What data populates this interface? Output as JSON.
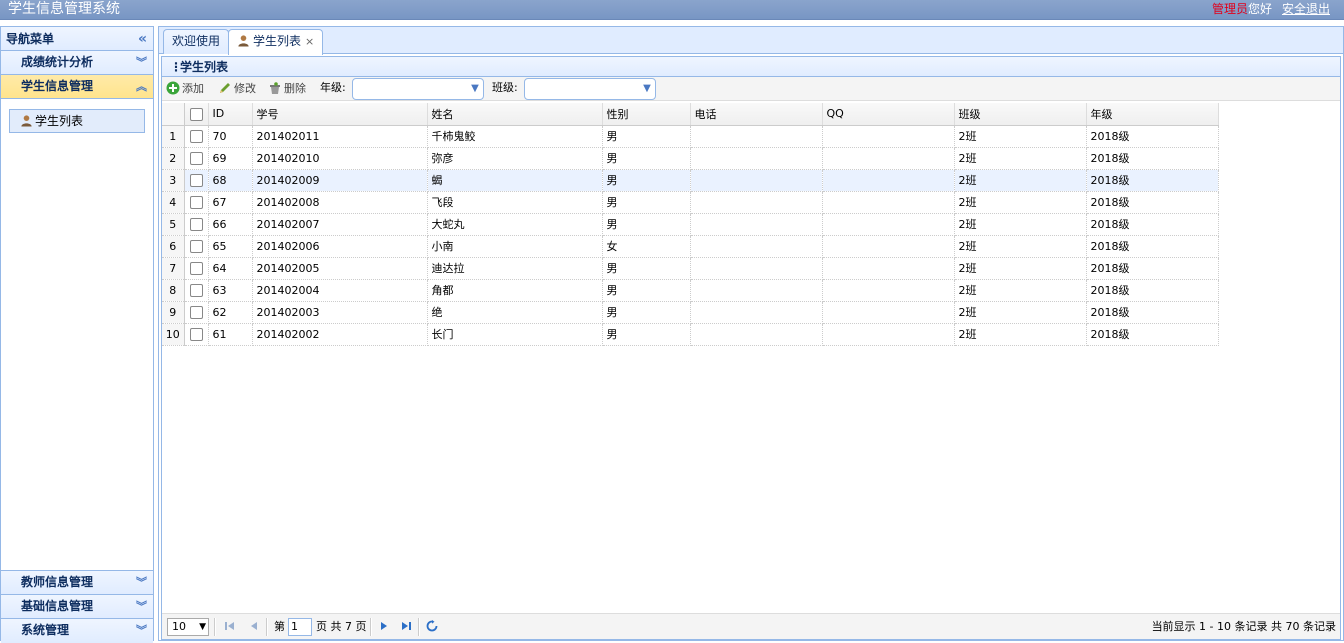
{
  "app": {
    "title": "学生信息管理系统"
  },
  "header": {
    "role": "管理员",
    "greeting": "您好",
    "logout": "安全退出"
  },
  "sidebar": {
    "title": "导航菜单",
    "groups": [
      {
        "label": "成绩统计分析"
      },
      {
        "label": "学生信息管理"
      },
      {
        "label": "教师信息管理"
      },
      {
        "label": "基础信息管理"
      },
      {
        "label": "系统管理"
      }
    ],
    "active_item": "学生列表"
  },
  "tabs": [
    {
      "label": "欢迎使用"
    },
    {
      "label": "学生列表"
    }
  ],
  "panel": {
    "title": "学生列表"
  },
  "toolbar": {
    "add": "添加",
    "edit": "修改",
    "delete": "删除",
    "grade_label": "年级:",
    "class_label": "班级:"
  },
  "table": {
    "columns": [
      "ID",
      "学号",
      "姓名",
      "性别",
      "电话",
      "QQ",
      "班级",
      "年级"
    ],
    "rows": [
      {
        "n": "1",
        "id": "70",
        "sno": "201402011",
        "name": "千柿鬼鲛",
        "sex": "男",
        "tel": "",
        "qq": "",
        "cls": "2班",
        "grade": "2018级"
      },
      {
        "n": "2",
        "id": "69",
        "sno": "201402010",
        "name": "弥彦",
        "sex": "男",
        "tel": "",
        "qq": "",
        "cls": "2班",
        "grade": "2018级"
      },
      {
        "n": "3",
        "id": "68",
        "sno": "201402009",
        "name": "蝎",
        "sex": "男",
        "tel": "",
        "qq": "",
        "cls": "2班",
        "grade": "2018级"
      },
      {
        "n": "4",
        "id": "67",
        "sno": "201402008",
        "name": "飞段",
        "sex": "男",
        "tel": "",
        "qq": "",
        "cls": "2班",
        "grade": "2018级"
      },
      {
        "n": "5",
        "id": "66",
        "sno": "201402007",
        "name": "大蛇丸",
        "sex": "男",
        "tel": "",
        "qq": "",
        "cls": "2班",
        "grade": "2018级"
      },
      {
        "n": "6",
        "id": "65",
        "sno": "201402006",
        "name": "小南",
        "sex": "女",
        "tel": "",
        "qq": "",
        "cls": "2班",
        "grade": "2018级"
      },
      {
        "n": "7",
        "id": "64",
        "sno": "201402005",
        "name": "迪达拉",
        "sex": "男",
        "tel": "",
        "qq": "",
        "cls": "2班",
        "grade": "2018级"
      },
      {
        "n": "8",
        "id": "63",
        "sno": "201402004",
        "name": "角都",
        "sex": "男",
        "tel": "",
        "qq": "",
        "cls": "2班",
        "grade": "2018级"
      },
      {
        "n": "9",
        "id": "62",
        "sno": "201402003",
        "name": "绝",
        "sex": "男",
        "tel": "",
        "qq": "",
        "cls": "2班",
        "grade": "2018级"
      },
      {
        "n": "10",
        "id": "61",
        "sno": "201402002",
        "name": "长门",
        "sex": "男",
        "tel": "",
        "qq": "",
        "cls": "2班",
        "grade": "2018级"
      }
    ]
  },
  "pager": {
    "page_size": "10",
    "page_prefix": "第",
    "current_page": "1",
    "page_suffix": "页 共 7 页",
    "info": "当前显示 1 - 10 条记录 共 70 条记录"
  },
  "colors": {
    "accent": "#95b8e7",
    "header_bg": "#7896c4",
    "active_group": "#ffe48d",
    "highlight_row": "#eaf2ff"
  }
}
